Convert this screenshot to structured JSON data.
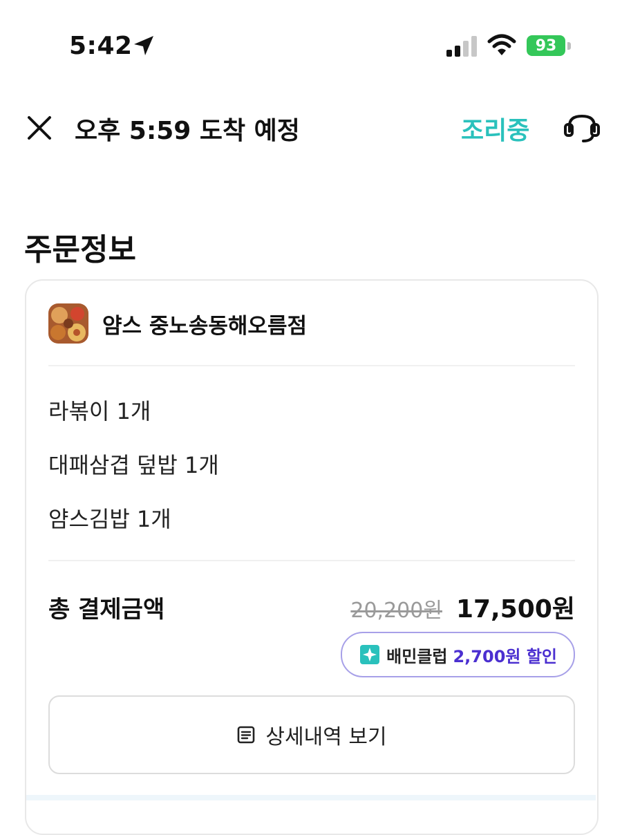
{
  "status_bar": {
    "time": "5:42",
    "battery": "93",
    "colors": {
      "battery": "#34c759"
    }
  },
  "header": {
    "title": "오후 5:59 도착 예정",
    "status": "조리중",
    "icons": {
      "close": "close-icon",
      "support": "headset-icon"
    },
    "colors": {
      "status": "#2ac1bc"
    }
  },
  "order_info": {
    "section_title": "주문정보",
    "store_name": "얌스 중노송동해오름점",
    "items": [
      {
        "label": "라볶이 1개"
      },
      {
        "label": "대패삼겹 덮밥 1개"
      },
      {
        "label": "얌스김밥 1개"
      }
    ],
    "total_label": "총 결제금액",
    "original_price": "20,200원",
    "final_price": "17,500원",
    "club": {
      "name": "배민클럽",
      "discount": "2,700원 할인",
      "colors": {
        "discount": "#4b2fd0",
        "border": "#a7a0e8",
        "icon": "#2ac1bc"
      }
    },
    "details_button": "상세내역 보기"
  }
}
